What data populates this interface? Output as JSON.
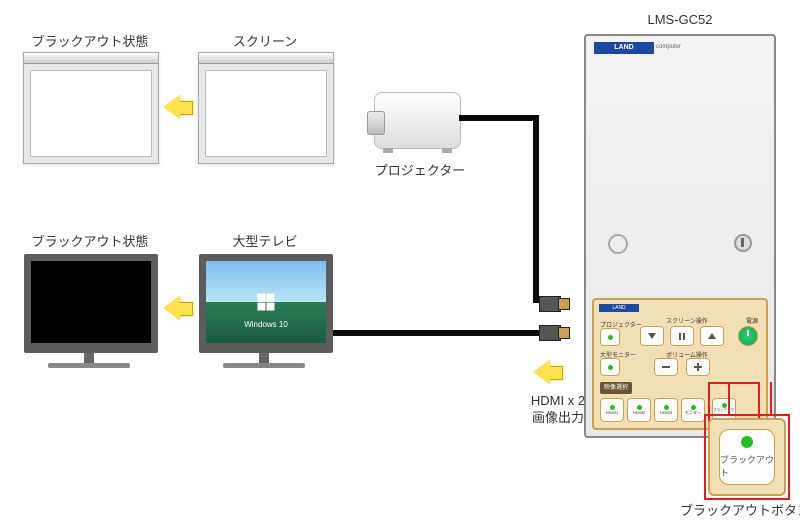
{
  "labels": {
    "blackout_state": "ブラックアウト状態",
    "screen": "スクリーン",
    "projector": "プロジェクター",
    "large_tv": "大型テレビ",
    "hdmi_output_l1": "HDMI x 2",
    "hdmi_output_l2": "画像出力",
    "device_model": "LMS-GC52",
    "blackout_button": "ブラックアウトボタン"
  },
  "screen_os_text": "Windows 10",
  "device": {
    "brand": "LAND",
    "brand_suffix": "computer",
    "panel_brand": "LAND"
  },
  "control_panel": {
    "screen_ops_label": "スクリーン操作",
    "power_label": "電源",
    "volume_ops_label": "ボリューム操作",
    "source_select_label": "映像選択",
    "source_buttons": [
      "HDMI1",
      "HDMI2",
      "HDMI3",
      "モニター",
      "ブラックアウト"
    ],
    "left_top_label": "プロジェクター",
    "left_mid_label": "大型モニター"
  },
  "callout_button_text": "ブラックアウト"
}
